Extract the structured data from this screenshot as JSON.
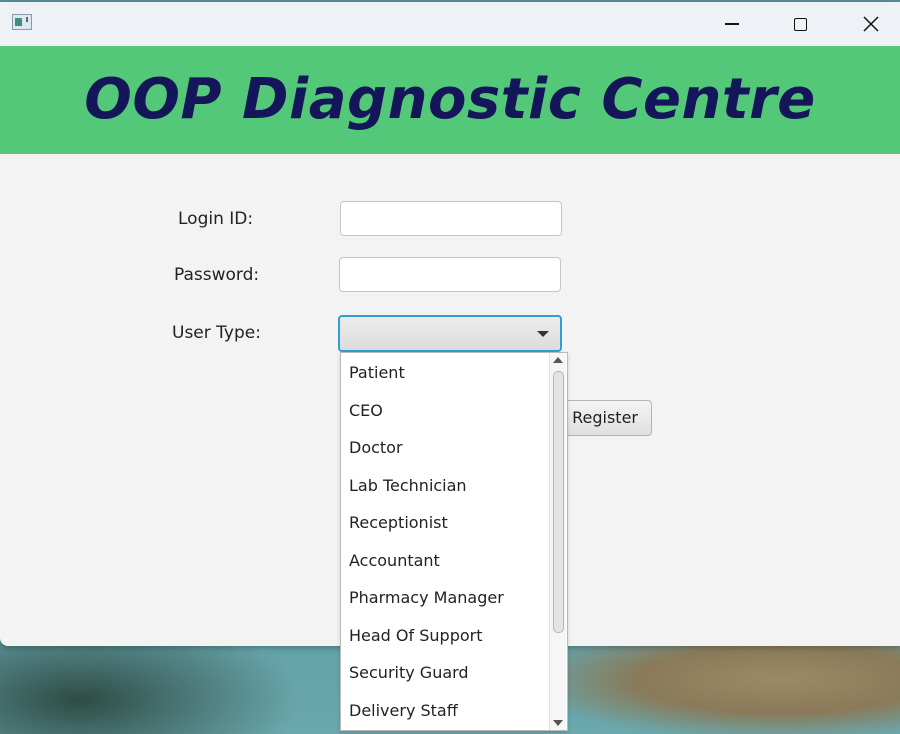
{
  "header": {
    "title": "OOP Diagnostic Centre"
  },
  "window_controls": {
    "minimize": "—",
    "maximize": "☐",
    "close": "✕"
  },
  "form": {
    "login_label": "Login ID:",
    "login_value": "",
    "password_label": "Password:",
    "password_value": "",
    "user_type_label": "User Type:",
    "user_type_selected": "",
    "register_label": "Register"
  },
  "dropdown": {
    "items": [
      "Patient",
      "CEO",
      "Doctor",
      "Lab Technician",
      "Receptionist",
      "Accountant",
      "Pharmacy Manager",
      "Head Of Support",
      "Security Guard",
      "Delivery Staff"
    ]
  },
  "colors": {
    "header_bg": "#52c878",
    "title_color": "#15155a",
    "focus_border": "#2f9fd6"
  }
}
